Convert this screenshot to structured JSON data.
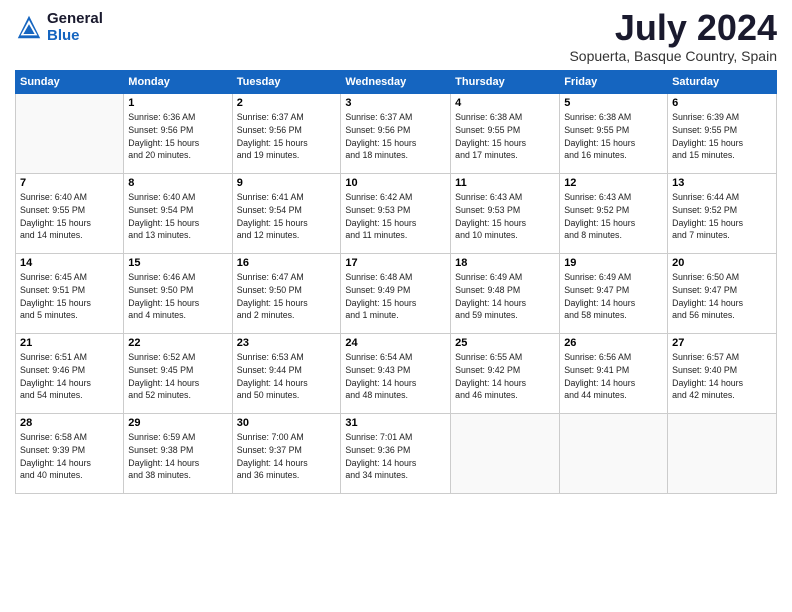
{
  "logo": {
    "line1": "General",
    "line2": "Blue"
  },
  "title": "July 2024",
  "subtitle": "Sopuerta, Basque Country, Spain",
  "days_of_week": [
    "Sunday",
    "Monday",
    "Tuesday",
    "Wednesday",
    "Thursday",
    "Friday",
    "Saturday"
  ],
  "weeks": [
    [
      {
        "day": "",
        "info": ""
      },
      {
        "day": "1",
        "info": "Sunrise: 6:36 AM\nSunset: 9:56 PM\nDaylight: 15 hours\nand 20 minutes."
      },
      {
        "day": "2",
        "info": "Sunrise: 6:37 AM\nSunset: 9:56 PM\nDaylight: 15 hours\nand 19 minutes."
      },
      {
        "day": "3",
        "info": "Sunrise: 6:37 AM\nSunset: 9:56 PM\nDaylight: 15 hours\nand 18 minutes."
      },
      {
        "day": "4",
        "info": "Sunrise: 6:38 AM\nSunset: 9:55 PM\nDaylight: 15 hours\nand 17 minutes."
      },
      {
        "day": "5",
        "info": "Sunrise: 6:38 AM\nSunset: 9:55 PM\nDaylight: 15 hours\nand 16 minutes."
      },
      {
        "day": "6",
        "info": "Sunrise: 6:39 AM\nSunset: 9:55 PM\nDaylight: 15 hours\nand 15 minutes."
      }
    ],
    [
      {
        "day": "7",
        "info": "Sunrise: 6:40 AM\nSunset: 9:55 PM\nDaylight: 15 hours\nand 14 minutes."
      },
      {
        "day": "8",
        "info": "Sunrise: 6:40 AM\nSunset: 9:54 PM\nDaylight: 15 hours\nand 13 minutes."
      },
      {
        "day": "9",
        "info": "Sunrise: 6:41 AM\nSunset: 9:54 PM\nDaylight: 15 hours\nand 12 minutes."
      },
      {
        "day": "10",
        "info": "Sunrise: 6:42 AM\nSunset: 9:53 PM\nDaylight: 15 hours\nand 11 minutes."
      },
      {
        "day": "11",
        "info": "Sunrise: 6:43 AM\nSunset: 9:53 PM\nDaylight: 15 hours\nand 10 minutes."
      },
      {
        "day": "12",
        "info": "Sunrise: 6:43 AM\nSunset: 9:52 PM\nDaylight: 15 hours\nand 8 minutes."
      },
      {
        "day": "13",
        "info": "Sunrise: 6:44 AM\nSunset: 9:52 PM\nDaylight: 15 hours\nand 7 minutes."
      }
    ],
    [
      {
        "day": "14",
        "info": "Sunrise: 6:45 AM\nSunset: 9:51 PM\nDaylight: 15 hours\nand 5 minutes."
      },
      {
        "day": "15",
        "info": "Sunrise: 6:46 AM\nSunset: 9:50 PM\nDaylight: 15 hours\nand 4 minutes."
      },
      {
        "day": "16",
        "info": "Sunrise: 6:47 AM\nSunset: 9:50 PM\nDaylight: 15 hours\nand 2 minutes."
      },
      {
        "day": "17",
        "info": "Sunrise: 6:48 AM\nSunset: 9:49 PM\nDaylight: 15 hours\nand 1 minute."
      },
      {
        "day": "18",
        "info": "Sunrise: 6:49 AM\nSunset: 9:48 PM\nDaylight: 14 hours\nand 59 minutes."
      },
      {
        "day": "19",
        "info": "Sunrise: 6:49 AM\nSunset: 9:47 PM\nDaylight: 14 hours\nand 58 minutes."
      },
      {
        "day": "20",
        "info": "Sunrise: 6:50 AM\nSunset: 9:47 PM\nDaylight: 14 hours\nand 56 minutes."
      }
    ],
    [
      {
        "day": "21",
        "info": "Sunrise: 6:51 AM\nSunset: 9:46 PM\nDaylight: 14 hours\nand 54 minutes."
      },
      {
        "day": "22",
        "info": "Sunrise: 6:52 AM\nSunset: 9:45 PM\nDaylight: 14 hours\nand 52 minutes."
      },
      {
        "day": "23",
        "info": "Sunrise: 6:53 AM\nSunset: 9:44 PM\nDaylight: 14 hours\nand 50 minutes."
      },
      {
        "day": "24",
        "info": "Sunrise: 6:54 AM\nSunset: 9:43 PM\nDaylight: 14 hours\nand 48 minutes."
      },
      {
        "day": "25",
        "info": "Sunrise: 6:55 AM\nSunset: 9:42 PM\nDaylight: 14 hours\nand 46 minutes."
      },
      {
        "day": "26",
        "info": "Sunrise: 6:56 AM\nSunset: 9:41 PM\nDaylight: 14 hours\nand 44 minutes."
      },
      {
        "day": "27",
        "info": "Sunrise: 6:57 AM\nSunset: 9:40 PM\nDaylight: 14 hours\nand 42 minutes."
      }
    ],
    [
      {
        "day": "28",
        "info": "Sunrise: 6:58 AM\nSunset: 9:39 PM\nDaylight: 14 hours\nand 40 minutes."
      },
      {
        "day": "29",
        "info": "Sunrise: 6:59 AM\nSunset: 9:38 PM\nDaylight: 14 hours\nand 38 minutes."
      },
      {
        "day": "30",
        "info": "Sunrise: 7:00 AM\nSunset: 9:37 PM\nDaylight: 14 hours\nand 36 minutes."
      },
      {
        "day": "31",
        "info": "Sunrise: 7:01 AM\nSunset: 9:36 PM\nDaylight: 14 hours\nand 34 minutes."
      },
      {
        "day": "",
        "info": ""
      },
      {
        "day": "",
        "info": ""
      },
      {
        "day": "",
        "info": ""
      }
    ]
  ]
}
